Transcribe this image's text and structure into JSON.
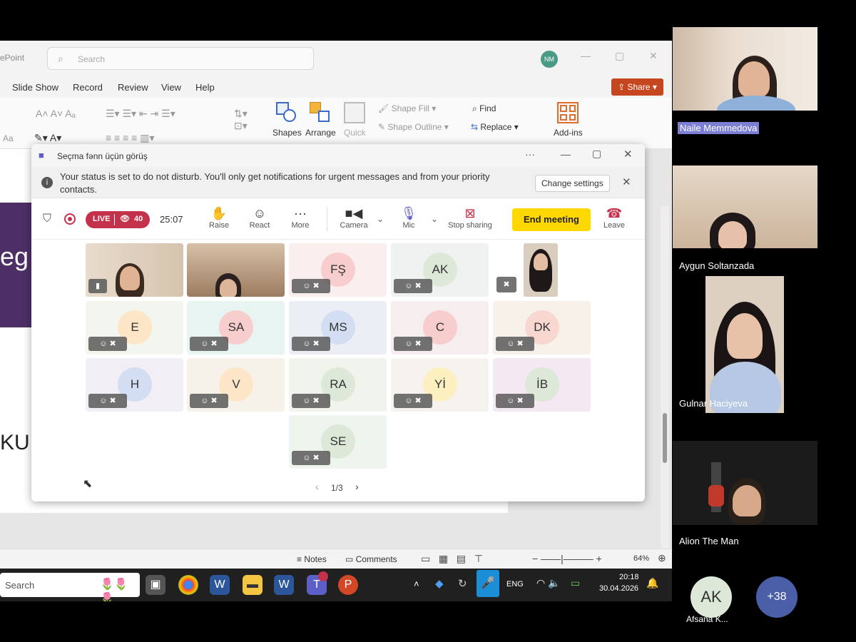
{
  "powerpoint": {
    "app_name": "ePoint",
    "search_placeholder": "Search",
    "avatar_initials": "NM",
    "menu": [
      "Slide Show",
      "Record",
      "Review",
      "View",
      "Help"
    ],
    "share_label": "Share",
    "ribbon": {
      "shapes": "Shapes",
      "arrange": "Arrange",
      "quick": "Quick",
      "shape_fill": "Shape Fill",
      "shape_outline": "Shape Outline",
      "find": "Find",
      "replace": "Replace",
      "addins": "Add-ins",
      "font_size_label": "Aa"
    },
    "slide_text_left": "eg",
    "slide_text_bottom": "KU",
    "status": {
      "notes": "Notes",
      "comments": "Comments",
      "zoom": "64%"
    }
  },
  "teams": {
    "window_title": "Seçma fənn üçün görüş",
    "notice_text": "Your status is set to do not disturb. You'll only get notifications for urgent messages and from your priority contacts.",
    "change_settings": "Change settings",
    "live_label": "LIVE",
    "viewer_count": "40",
    "timer": "25:07",
    "buttons": {
      "raise": "Raise",
      "react": "React",
      "more": "More",
      "camera": "Camera",
      "mic": "Mic",
      "stop_sharing": "Stop sharing",
      "end_meeting": "End meeting",
      "leave": "Leave"
    },
    "tiles": [
      "FŞ",
      "AK",
      "E",
      "SA",
      "MS",
      "C",
      "DK",
      "H",
      "V",
      "RA",
      "Yİ",
      "İB",
      "SE"
    ],
    "pagination": "1/3"
  },
  "taskbar": {
    "search": "Search",
    "lang": "ENG",
    "time": "20:18",
    "date": "30.04.2026"
  },
  "participants": [
    {
      "name": "Naile Memmedova"
    },
    {
      "name": "Aygun Soltanzada"
    },
    {
      "name": "Gulnar Haciyeva"
    },
    {
      "name": "Alion The Man"
    }
  ],
  "footer": {
    "avatar_initials": "AK",
    "avatar_name": "Afsana K...",
    "more_count": "+38"
  }
}
